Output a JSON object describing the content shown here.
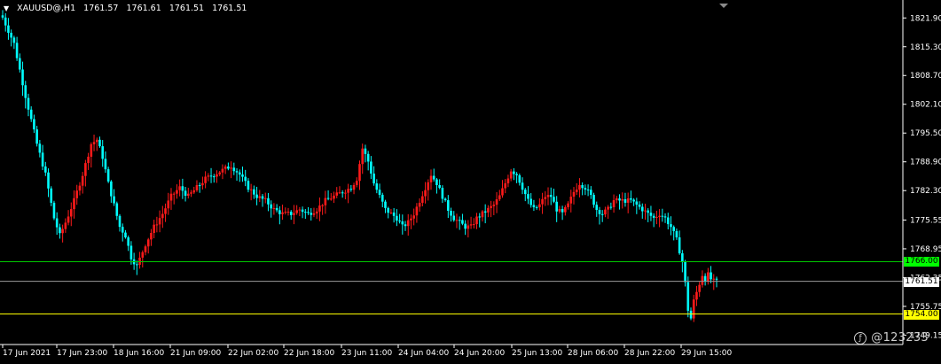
{
  "header": {
    "symbol": "XAUUSD@,H1",
    "ohlc": [
      "1761.57",
      "1761.61",
      "1761.51",
      "1761.51"
    ]
  },
  "watermark": "@123233",
  "colors": {
    "background": "#000000",
    "up": "#ff1a1a",
    "down": "#00ffff",
    "grid_axis": "#ffffff",
    "green_line": "#00c800",
    "yellow_line": "#ffff00",
    "bid_line": "#9a9a9a"
  },
  "chart_data": {
    "type": "candlestick",
    "title": "XAUUSD@,H1",
    "y_ticks": [
      "1821.90",
      "1815.30",
      "1808.70",
      "1802.10",
      "1795.50",
      "1788.90",
      "1782.30",
      "1775.55",
      "1768.95",
      "1762.35",
      "1755.75",
      "1749.15"
    ],
    "x_ticks": [
      "17 Jun 2021",
      "17 Jun 23:00",
      "18 Jun 16:00",
      "21 Jun 09:00",
      "22 Jun 02:00",
      "22 Jun 18:00",
      "23 Jun 11:00",
      "24 Jun 04:00",
      "24 Jun 20:00",
      "25 Jun 13:00",
      "28 Jun 06:00",
      "28 Jun 22:00",
      "29 Jun 15:00"
    ],
    "ylim": [
      1747,
      1825
    ],
    "horizontal_lines": [
      {
        "label": "1766.00",
        "value": 1766.0,
        "color": "green"
      },
      {
        "label": "1761.51",
        "value": 1761.51,
        "color": "gray"
      },
      {
        "label": "1754.00",
        "value": 1754.0,
        "color": "yellow"
      }
    ],
    "close_path": [
      [
        0,
        1822
      ],
      [
        4,
        1816
      ],
      [
        8,
        1804
      ],
      [
        12,
        1793
      ],
      [
        15,
        1786
      ],
      [
        18,
        1776
      ],
      [
        20,
        1772
      ],
      [
        22,
        1775
      ],
      [
        25,
        1780
      ],
      [
        28,
        1786
      ],
      [
        31,
        1793
      ],
      [
        33,
        1794
      ],
      [
        35,
        1790
      ],
      [
        37,
        1784
      ],
      [
        39,
        1779
      ],
      [
        41,
        1774
      ],
      [
        43,
        1772
      ],
      [
        45,
        1767
      ],
      [
        47,
        1765
      ],
      [
        50,
        1770
      ],
      [
        53,
        1774
      ],
      [
        56,
        1777
      ],
      [
        59,
        1781
      ],
      [
        62,
        1783
      ],
      [
        65,
        1781
      ],
      [
        68,
        1783
      ],
      [
        71,
        1785
      ],
      [
        74,
        1786
      ],
      [
        77,
        1787
      ],
      [
        80,
        1788
      ],
      [
        83,
        1786
      ],
      [
        86,
        1783
      ],
      [
        89,
        1781
      ],
      [
        92,
        1780
      ],
      [
        95,
        1778
      ],
      [
        98,
        1777
      ],
      [
        101,
        1777
      ],
      [
        104,
        1778
      ],
      [
        107,
        1777
      ],
      [
        110,
        1778
      ],
      [
        113,
        1780
      ],
      [
        116,
        1781
      ],
      [
        119,
        1782
      ],
      [
        122,
        1783
      ],
      [
        124,
        1785
      ],
      [
        126,
        1792
      ],
      [
        128,
        1789
      ],
      [
        130,
        1784
      ],
      [
        132,
        1781
      ],
      [
        134,
        1778
      ],
      [
        136,
        1777
      ],
      [
        138,
        1776
      ],
      [
        140,
        1774
      ],
      [
        142,
        1775
      ],
      [
        144,
        1777
      ],
      [
        146,
        1780
      ],
      [
        148,
        1783
      ],
      [
        150,
        1786
      ],
      [
        152,
        1784
      ],
      [
        154,
        1781
      ],
      [
        156,
        1778
      ],
      [
        158,
        1776
      ],
      [
        160,
        1775
      ],
      [
        162,
        1774
      ],
      [
        164,
        1774
      ],
      [
        166,
        1776
      ],
      [
        168,
        1777
      ],
      [
        170,
        1778
      ],
      [
        172,
        1779
      ],
      [
        174,
        1781
      ],
      [
        176,
        1784
      ],
      [
        178,
        1787
      ],
      [
        180,
        1786
      ],
      [
        182,
        1783
      ],
      [
        184,
        1780
      ],
      [
        186,
        1778
      ],
      [
        188,
        1779
      ],
      [
        190,
        1781
      ],
      [
        192,
        1781
      ],
      [
        194,
        1778
      ],
      [
        196,
        1777
      ],
      [
        198,
        1779
      ],
      [
        200,
        1782
      ],
      [
        202,
        1784
      ],
      [
        204,
        1783
      ],
      [
        206,
        1781
      ],
      [
        208,
        1778
      ],
      [
        210,
        1777
      ],
      [
        212,
        1778
      ],
      [
        214,
        1780
      ],
      [
        216,
        1780
      ],
      [
        218,
        1780
      ],
      [
        220,
        1780
      ],
      [
        222,
        1779
      ],
      [
        224,
        1778
      ],
      [
        226,
        1777
      ],
      [
        228,
        1776
      ],
      [
        230,
        1777
      ],
      [
        232,
        1776
      ],
      [
        234,
        1774
      ],
      [
        236,
        1771
      ],
      [
        238,
        1766
      ],
      [
        239,
        1761
      ],
      [
        240,
        1755
      ],
      [
        241,
        1753
      ],
      [
        242,
        1757
      ],
      [
        243,
        1759
      ],
      [
        244,
        1761
      ],
      [
        245,
        1763
      ],
      [
        246,
        1762
      ],
      [
        247,
        1763
      ],
      [
        248,
        1762
      ],
      [
        249,
        1761.5
      ],
      [
        250,
        1761.5
      ]
    ]
  }
}
